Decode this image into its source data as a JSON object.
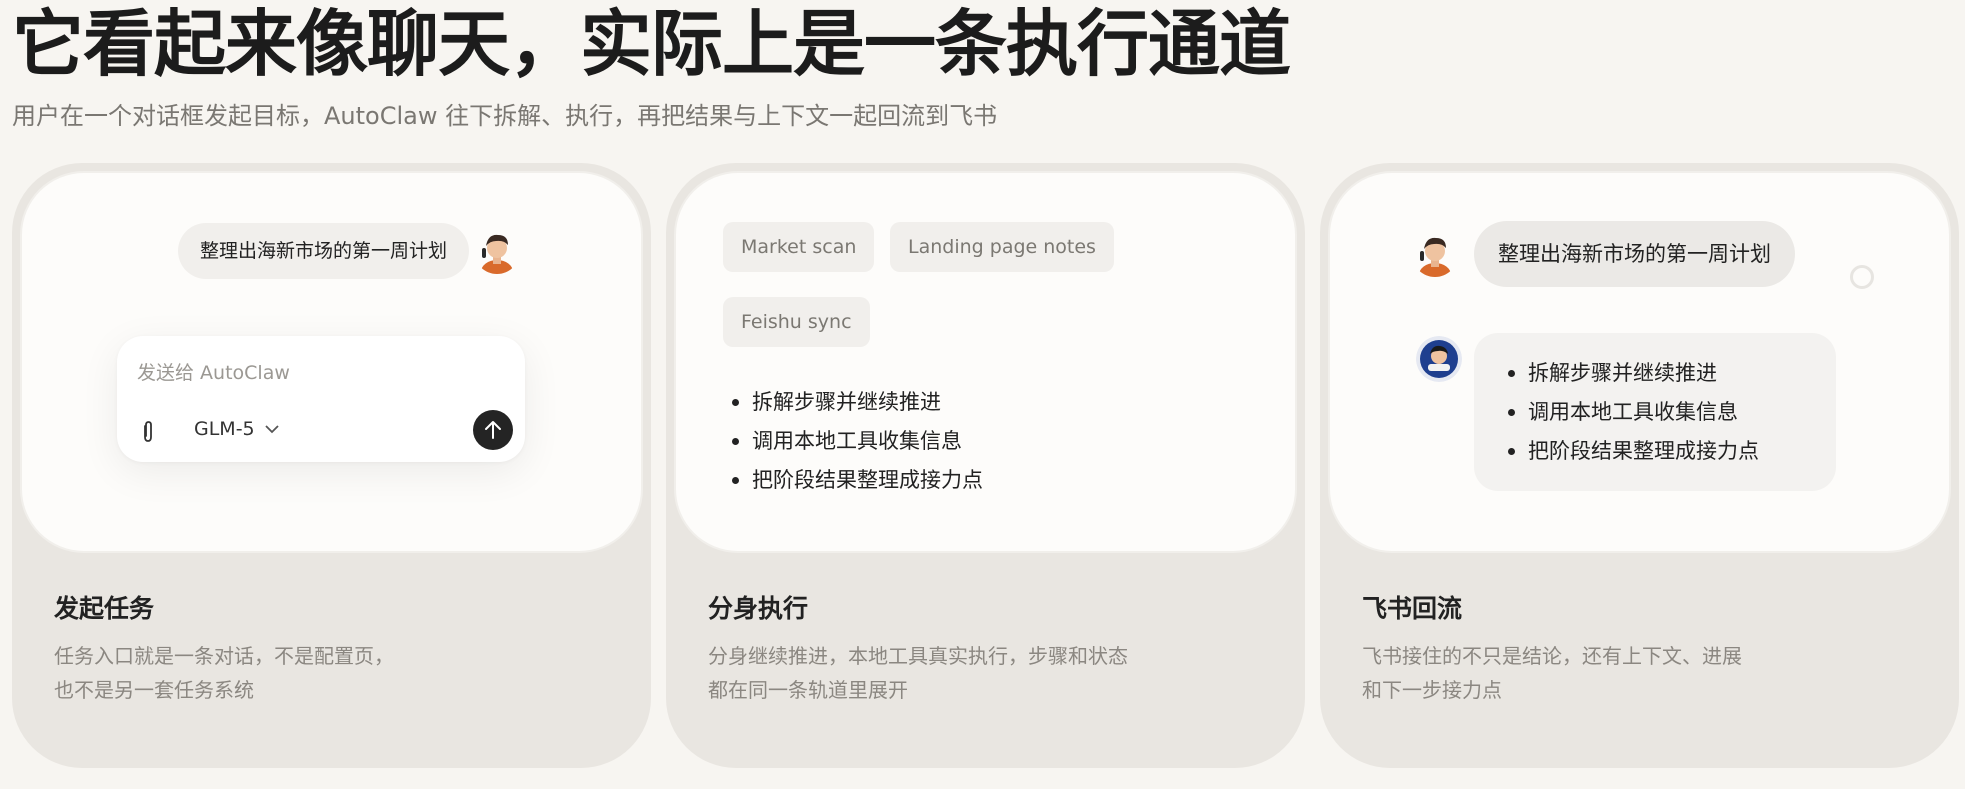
{
  "header": {
    "title": "它看起来像聊天，实际上是一条执行通道",
    "subtitle": "用户在一个对话框发起目标，AutoClaw 往下拆解、执行，再把结果与上下文一起回流到飞书"
  },
  "cards": [
    {
      "title": "发起任务",
      "desc_lines": [
        "任务入口就是一条对话，不是配置页，",
        "也不是另一套任务系统"
      ],
      "user_message": "整理出海新市场的第一周计划",
      "composer": {
        "placeholder": "发送给 AutoClaw",
        "model": "GLM-5",
        "attach_icon": "paperclip-icon",
        "send_icon": "arrow-up-icon"
      }
    },
    {
      "title": "分身执行",
      "desc_lines": [
        "分身继续推进，本地工具真实执行，步骤和状态",
        "都在同一条轨道里展开"
      ],
      "chips": [
        "Market scan",
        "Landing page notes",
        "Feishu sync"
      ],
      "steps": [
        "拆解步骤并继续推进",
        "调用本地工具收集信息",
        "把阶段结果整理成接力点"
      ]
    },
    {
      "title": "飞书回流",
      "desc_lines": [
        "飞书接住的不只是结论，还有上下文、进展",
        "和下一步接力点"
      ],
      "user_message": "整理出海新市场的第一周计划",
      "reply_items": [
        "拆解步骤并继续推进",
        "调用本地工具收集信息",
        "把阶段结果整理成接力点"
      ]
    }
  ],
  "colors": {
    "page_bg": "#f7f5f1",
    "card_bg": "#e9e6e1",
    "inner_bg": "#fdfcfa",
    "send_button": "#242424"
  }
}
